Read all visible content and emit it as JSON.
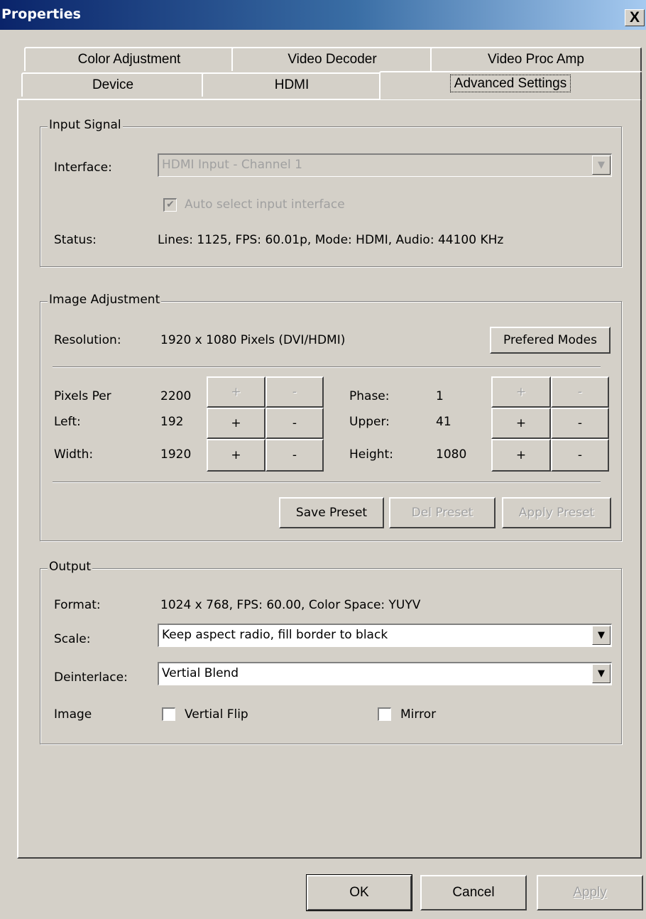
{
  "window": {
    "title": "Properties",
    "close_label": "X"
  },
  "tabs_back": [
    "Color Adjustment",
    "Video Decoder",
    "Video Proc Amp"
  ],
  "tabs_front": [
    "Device",
    "HDMI",
    "Advanced Settings"
  ],
  "input_signal": {
    "legend": "Input Signal",
    "interface_label": "Interface:",
    "interface_value": "HDMI Input - Channel 1",
    "auto_select_label": "Auto select input interface",
    "auto_select_checked": true,
    "status_label": "Status:",
    "status_value": "Lines: 1125, FPS: 60.01p, Mode: HDMI, Audio: 44100 KHz"
  },
  "image_adjustment": {
    "legend": "Image Adjustment",
    "resolution_label": "Resolution:",
    "resolution_value": "1920 x 1080 Pixels (DVI/HDMI)",
    "prefered_modes_label": "Prefered Modes",
    "plus": "+",
    "minus": "-",
    "pixels_per_label": "Pixels Per",
    "pixels_per_value": "2200",
    "left_label": "Left:",
    "left_value": "192",
    "width_label": "Width:",
    "width_value": "1920",
    "phase_label": "Phase:",
    "phase_value": "1",
    "upper_label": "Upper:",
    "upper_value": "41",
    "height_label": "Height:",
    "height_value": "1080",
    "save_preset_label": "Save Preset",
    "del_preset_label": "Del Preset",
    "apply_preset_label": "Apply Preset"
  },
  "output": {
    "legend": "Output",
    "format_label": "Format:",
    "format_value": "1024 x 768, FPS: 60.00, Color Space: YUYV",
    "scale_label": "Scale:",
    "scale_value": "Keep aspect radio, fill border to black",
    "deinterlace_label": "Deinterlace:",
    "deinterlace_value": "Vertial Blend",
    "image_label": "Image",
    "vertial_flip_label": "Vertial Flip",
    "mirror_label": "Mirror"
  },
  "footer": {
    "ok_label": "OK",
    "cancel_label": "Cancel",
    "apply_label": "Apply"
  },
  "icons": {
    "combo_arrow": "chevron-down-icon",
    "check": "checkmark-icon"
  }
}
